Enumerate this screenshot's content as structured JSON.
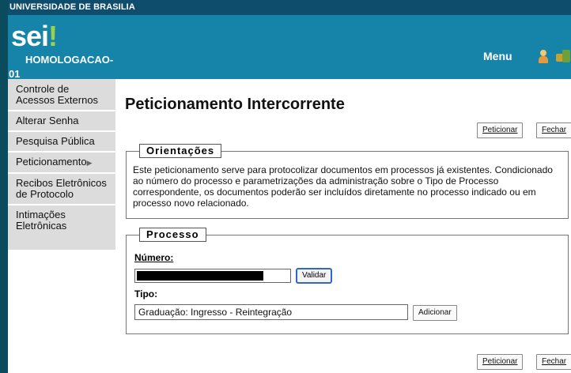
{
  "topbar": {
    "institution": "UNIVERSIDADE DE BRASILIA"
  },
  "header": {
    "logo_text": "sei",
    "logo_mark": "!",
    "unit_line1": "HOMOLOGACAO-",
    "unit_line2": "01",
    "menu_label": "Menu",
    "icons": [
      "user-icon",
      "switch-unit-icon"
    ]
  },
  "sidebar": {
    "items": [
      {
        "label": "Controle de Acessos Externos"
      },
      {
        "label": "Alterar Senha"
      },
      {
        "label": "Pesquisa Pública"
      },
      {
        "label": "Peticionamento",
        "has_submenu": true
      },
      {
        "label": "Recibos Eletrônicos de Protocolo"
      },
      {
        "label": "Intimações Eletrônicas"
      }
    ]
  },
  "page": {
    "title": "Peticionamento Intercorrente",
    "peticionar_label": "Peticionar",
    "fechar_label": "Fechar"
  },
  "orientacoes": {
    "legend": "Orientações",
    "text": "Este peticionamento serve para protocolizar documentos em processos já existentes. Condicionado ao número do processo e parametrizações da administração sobre o Tipo de Processo correspondente, os documentos poderão ser incluídos diretamente no processo indicado ou em processo novo relacionado."
  },
  "processo": {
    "legend": "Processo",
    "numero_label": "Número:",
    "numero_value": "",
    "validar_label": "Validar",
    "tipo_label": "Tipo:",
    "tipo_value": "Graduação: Ingresso - Reintegração",
    "adicionar_label": "Adicionar"
  },
  "colors": {
    "header": "#1584a8",
    "topbar": "#0f4d6c",
    "sidebar": "#dcdcdc",
    "logo_accent": "#9cd14a"
  }
}
